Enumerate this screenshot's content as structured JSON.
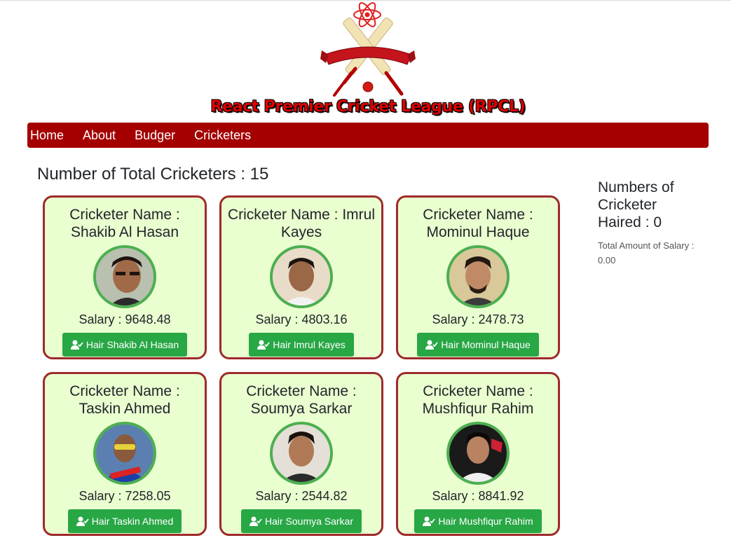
{
  "header": {
    "title": "React Premier Cricket League (RPCL)"
  },
  "nav": {
    "items": [
      {
        "label": "Home"
      },
      {
        "label": "About"
      },
      {
        "label": "Budger"
      },
      {
        "label": "Cricketers"
      }
    ]
  },
  "main": {
    "total_label": "Number of Total Cricketers : 15",
    "cards": [
      {
        "name": "Cricketer Name : Shakib Al Hasan",
        "salary": "Salary : 9648.48",
        "button": "Hair Shakib Al Hasan"
      },
      {
        "name": "Cricketer Name : Imrul Kayes",
        "salary": "Salary : 4803.16",
        "button": "Hair Imrul Kayes"
      },
      {
        "name": "Cricketer Name : Mominul Haque",
        "salary": "Salary : 2478.73",
        "button": "Hair Mominul Haque"
      },
      {
        "name": "Cricketer Name : Taskin Ahmed",
        "salary": "Salary : 7258.05",
        "button": "Hair Taskin Ahmed"
      },
      {
        "name": "Cricketer Name : Soumya Sarkar",
        "salary": "Salary : 2544.82",
        "button": "Hair Soumya Sarkar"
      },
      {
        "name": "Cricketer Name : Mushfiqur Rahim",
        "salary": "Salary : 8841.92",
        "button": "Hair Mushfiqur Rahim"
      }
    ]
  },
  "side": {
    "hired_label": "Numbers of Cricketer Haired : 0",
    "total_salary_label": "Total Amount of Salary : 0.00"
  },
  "colors": {
    "nav_bg": "#a50000",
    "card_bg": "#eaffd0",
    "card_border": "#9e2a2b",
    "button_bg": "#28a745",
    "avatar_ring": "#4caf50"
  },
  "icons": {
    "button_icon": "user-check-icon",
    "logo": "cricket-bats-react-logo"
  }
}
